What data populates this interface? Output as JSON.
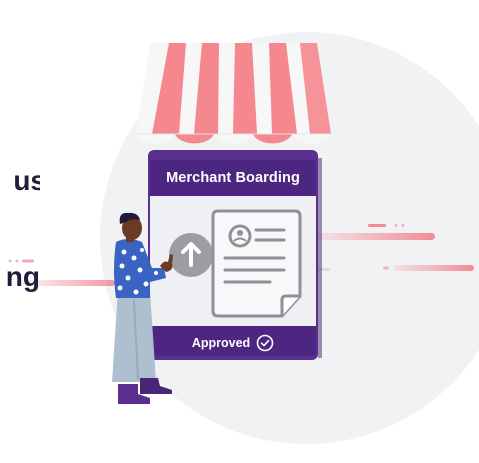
{
  "heading": {
    "line1": "us",
    "line2": "ng"
  },
  "card": {
    "title": "Merchant Boarding",
    "status": "Approved"
  },
  "colors": {
    "purple": "#5b2f8f",
    "purple_dark": "#3b2266",
    "awning_pink": "#f5878e",
    "awning_white": "#f7f7f7",
    "accent_pink": "#f38b97",
    "doc_gray": "#8f9194",
    "person_top": "#3a63c4",
    "person_pants": "#aebfd0"
  },
  "icons": {
    "upload": "arrow-up-circle-icon",
    "document": "profile-document-icon",
    "check": "check-circle-icon"
  }
}
